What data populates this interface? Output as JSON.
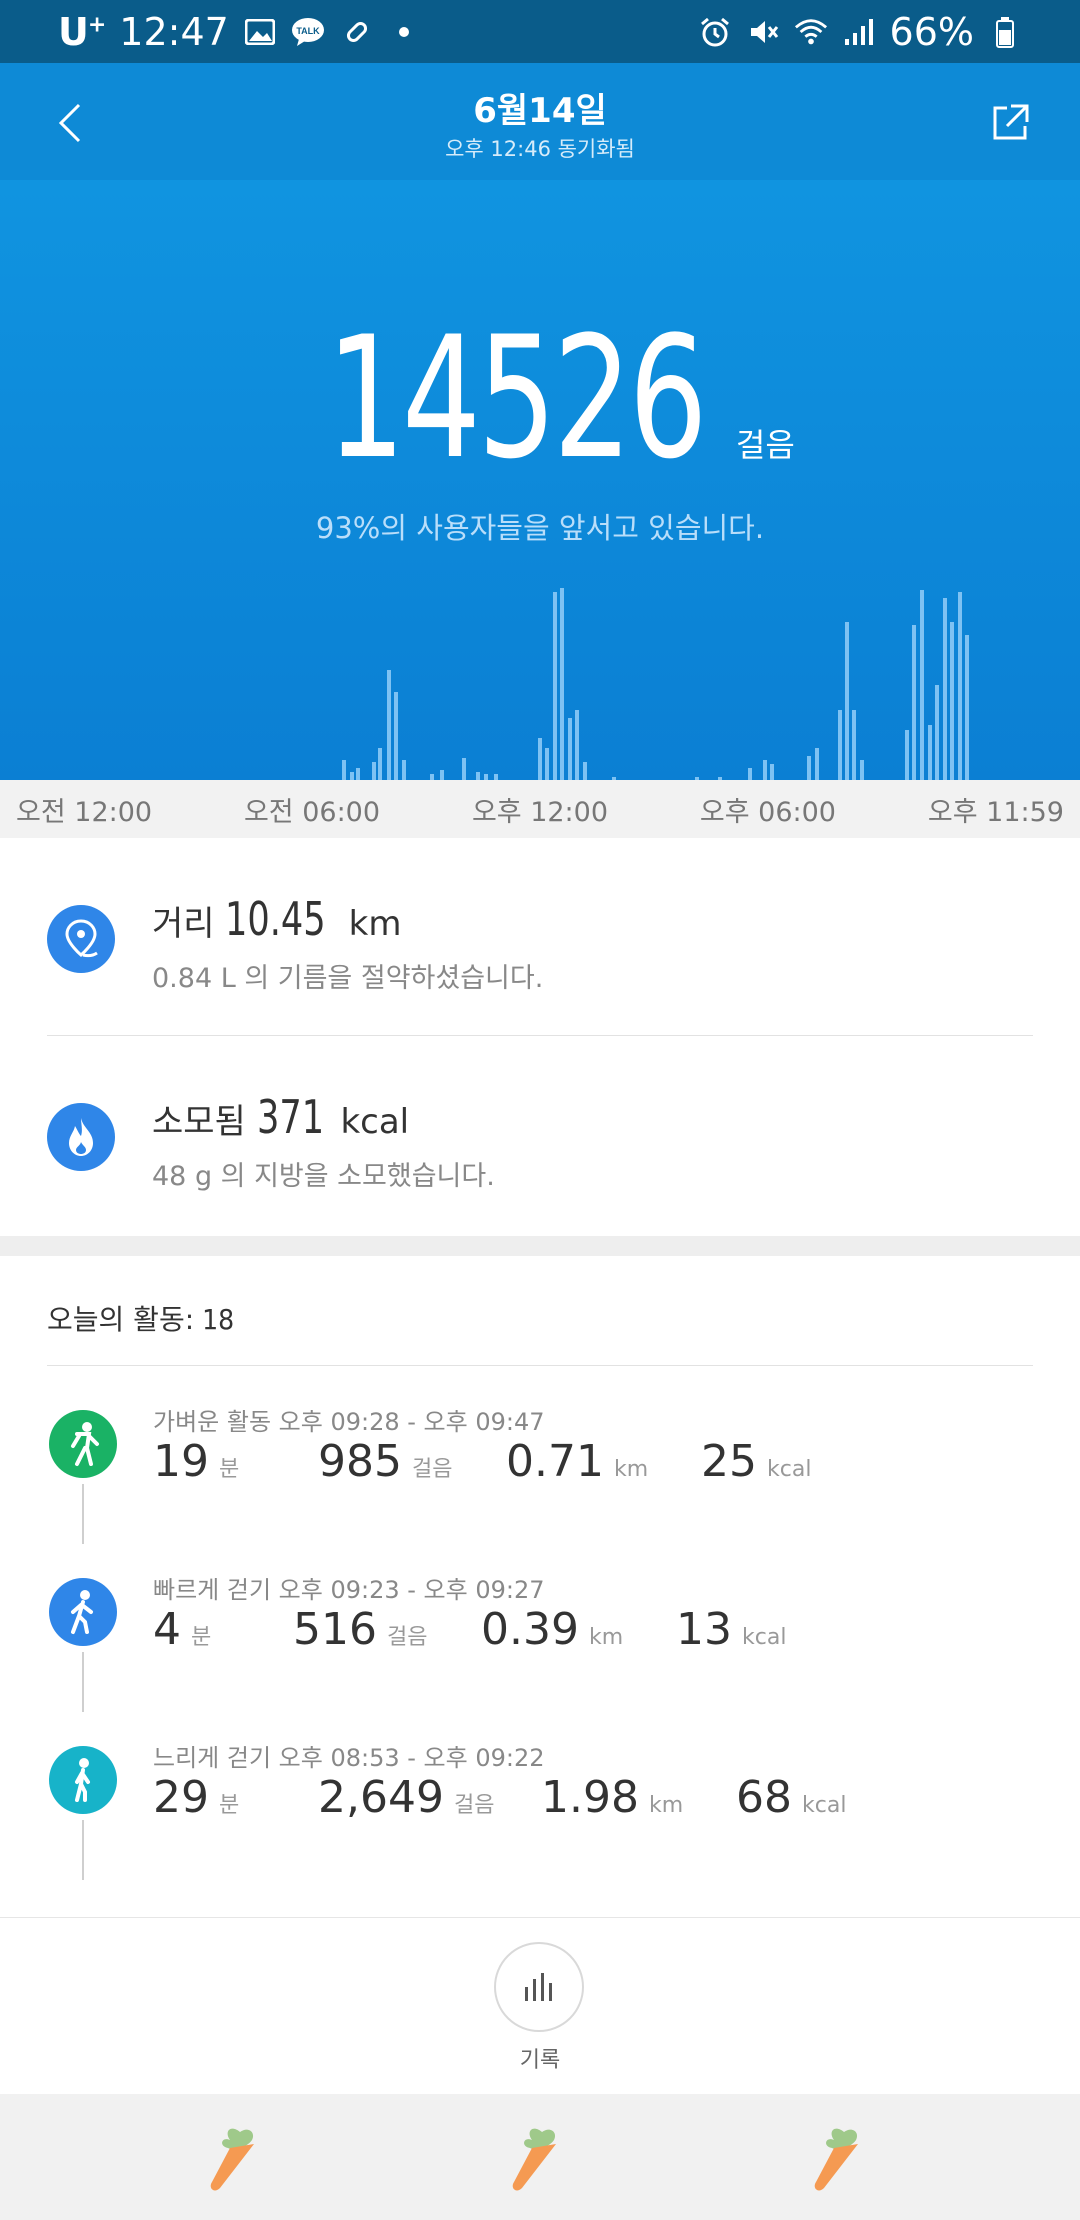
{
  "status_bar": {
    "carrier": "U",
    "carrier_sup": "+",
    "time": "12:47",
    "battery": "66%"
  },
  "header": {
    "title": "6월14일",
    "subtitle": "오후 12:46 동기화됨"
  },
  "hero": {
    "steps": "14526",
    "steps_unit": "걸음",
    "rank_text": "93%의 사용자들을 앞서고 있습니다."
  },
  "time_axis": [
    "오전 12:00",
    "오전 06:00",
    "오후 12:00",
    "오후 06:00",
    "오후 11:59"
  ],
  "distance": {
    "label": "거리",
    "value": "10.45",
    "unit": "km",
    "note": "0.84 L 의 기름을 절약하셨습니다."
  },
  "calories": {
    "label": "소모됨",
    "value": "371",
    "unit": "kcal",
    "note": "48 g 의 지방을 소모했습니다."
  },
  "activities": {
    "title": "오늘의 활동:",
    "count": "18",
    "items": [
      {
        "label": "가벼운 활동 오후 09:28 - 오후 09:47",
        "icon": "light-activity-icon",
        "color": "#1ab265",
        "minutes": "19",
        "minutes_unit": "분",
        "steps": "985",
        "steps_unit": "걸음",
        "distance": "0.71",
        "distance_unit": "km",
        "kcal": "25",
        "kcal_unit": "kcal"
      },
      {
        "label": "빠르게 걷기 오후 09:23 - 오후 09:27",
        "icon": "fast-walk-icon",
        "color": "#2f86e8",
        "minutes": "4",
        "minutes_unit": "분",
        "steps": "516",
        "steps_unit": "걸음",
        "distance": "0.39",
        "distance_unit": "km",
        "kcal": "13",
        "kcal_unit": "kcal"
      },
      {
        "label": "느리게 걷기 오후 08:53 - 오후 09:22",
        "icon": "slow-walk-icon",
        "color": "#17b3c9",
        "minutes": "29",
        "minutes_unit": "분",
        "steps": "2,649",
        "steps_unit": "걸음",
        "distance": "1.98",
        "distance_unit": "km",
        "kcal": "68",
        "kcal_unit": "kcal"
      }
    ]
  },
  "record": {
    "label": "기록"
  },
  "colors": {
    "header_bg": "#0e8ad6",
    "status_bg": "#0a5c8a",
    "accent_blue": "#2f86e8"
  }
}
